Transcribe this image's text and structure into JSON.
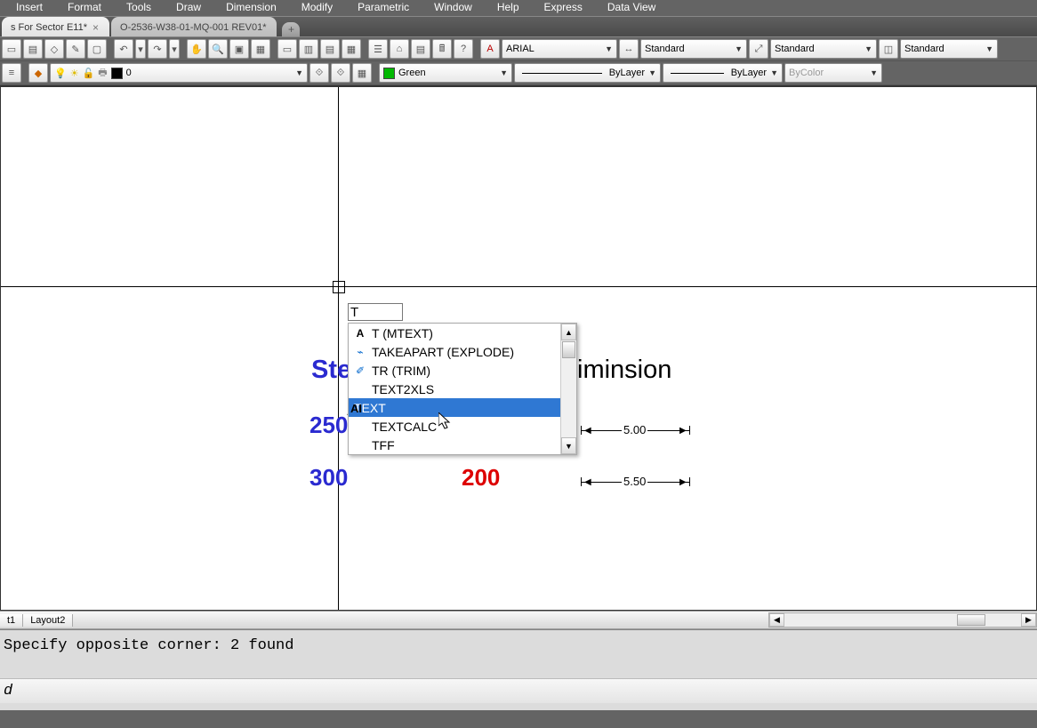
{
  "menu": [
    "Insert",
    "Format",
    "Tools",
    "Draw",
    "Dimension",
    "Modify",
    "Parametric",
    "Window",
    "Help",
    "Express",
    "Data View"
  ],
  "tabs": {
    "active": "s For Sector E11*",
    "inactive": "O-2536-W38-01-MQ-001 REV01*"
  },
  "styles": {
    "font": "ARIAL",
    "text_style": "Standard",
    "dim_style": "Standard",
    "table_style": "Standard"
  },
  "layer": {
    "name": "0",
    "color_name": "Green",
    "color_hex": "#00B800",
    "linetype": "ByLayer",
    "lineweight": "ByLayer",
    "plotstyle": "ByColor"
  },
  "canvas": {
    "title_frag_left": "Ste",
    "title_frag_right": "iminsion",
    "dim1": "5.00",
    "dim2": "5.50",
    "val_250": "250",
    "val_300": "300",
    "val_200": "200",
    "ai_label": "AI"
  },
  "command_input": "T",
  "autocomplete": [
    {
      "icon": "A",
      "label": "T (MTEXT)"
    },
    {
      "icon": "⌘",
      "label": "TAKEAPART (EXPLODE)"
    },
    {
      "icon": "✐",
      "label": "TR (TRIM)"
    },
    {
      "icon": "",
      "label": "TEXT2XLS"
    },
    {
      "icon": "AI",
      "label": "TEXT",
      "selected": true
    },
    {
      "icon": "",
      "label": "TEXTCALC"
    },
    {
      "icon": "",
      "label": "TFF"
    }
  ],
  "layout_tabs": [
    "t1",
    "Layout2"
  ],
  "command_history": "Specify opposite corner: 2 found",
  "command_prompt": "d"
}
